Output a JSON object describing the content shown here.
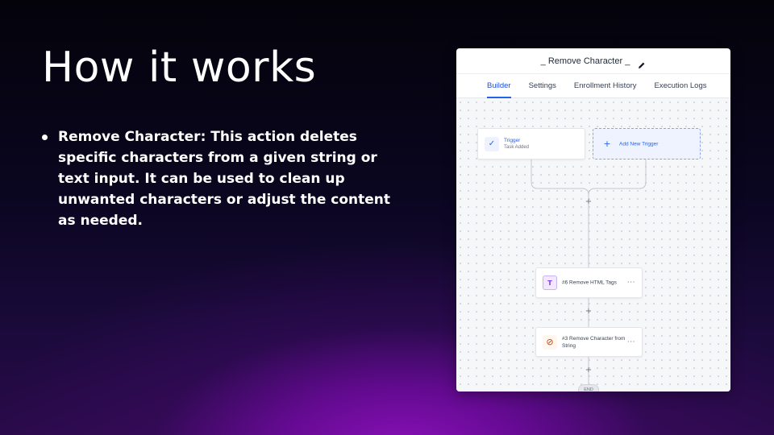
{
  "slide": {
    "title": "How it works",
    "bullets": [
      "Remove Character: This action deletes specific characters from a given string or text input. It can be used to clean up unwanted characters or adjust the content as needed."
    ]
  },
  "workflow": {
    "title": "_ Remove Character _",
    "tabs": [
      {
        "label": "Builder",
        "active": true
      },
      {
        "label": "Settings",
        "active": false
      },
      {
        "label": "Enrollment History",
        "active": false
      },
      {
        "label": "Execution Logs",
        "active": false
      }
    ],
    "trigger": {
      "label": "Trigger",
      "sub": "Task Added",
      "icon": "check-icon"
    },
    "add_trigger": {
      "label": "Add New Trigger",
      "icon": "plus-icon"
    },
    "actions": [
      {
        "label": "#6 Remove HTML Tags",
        "label2": "",
        "icon": "text-format-icon",
        "icon_color": "#7c3aed"
      },
      {
        "label": "#3 Remove Character from",
        "label2": "String",
        "icon": "block-icon",
        "icon_color": "#c2410c"
      }
    ],
    "more_label": "···",
    "plus_label": "+",
    "end_label": "END"
  },
  "colors": {
    "accent": "#2563eb",
    "background_glow": "#8a10b8"
  }
}
